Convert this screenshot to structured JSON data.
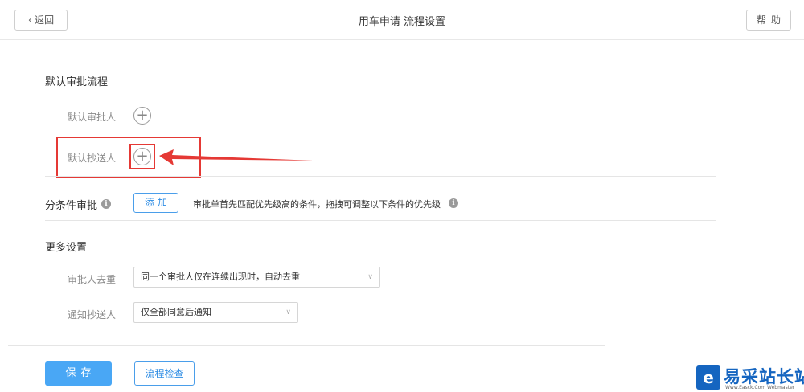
{
  "header": {
    "back_label": "返回",
    "title": "用车申请 流程设置",
    "help_label": "帮助"
  },
  "default_flow": {
    "title": "默认审批流程",
    "approver_label": "默认审批人",
    "cc_label": "默认抄送人",
    "add_icon": "plus-circle-icon"
  },
  "conditional": {
    "title": "分条件审批",
    "add_label": "添加",
    "hint": "审批单首先匹配优先级高的条件，拖拽可调整以下条件的优先级",
    "info_icon": "info-icon"
  },
  "more_settings": {
    "title": "更多设置",
    "dedupe_label": "审批人去重",
    "dedupe_value": "同一个审批人仅在连续出现时，自动去重",
    "notify_label": "通知抄送人",
    "notify_value": "仅全部同意后通知"
  },
  "footer": {
    "save_label": "保存",
    "check_label": "流程检查"
  },
  "watermark": {
    "text": "易采站长站",
    "sub": "Www.Easck.Com Webmaster"
  },
  "colors": {
    "accent": "#49a7f5",
    "highlight": "#e53935"
  }
}
